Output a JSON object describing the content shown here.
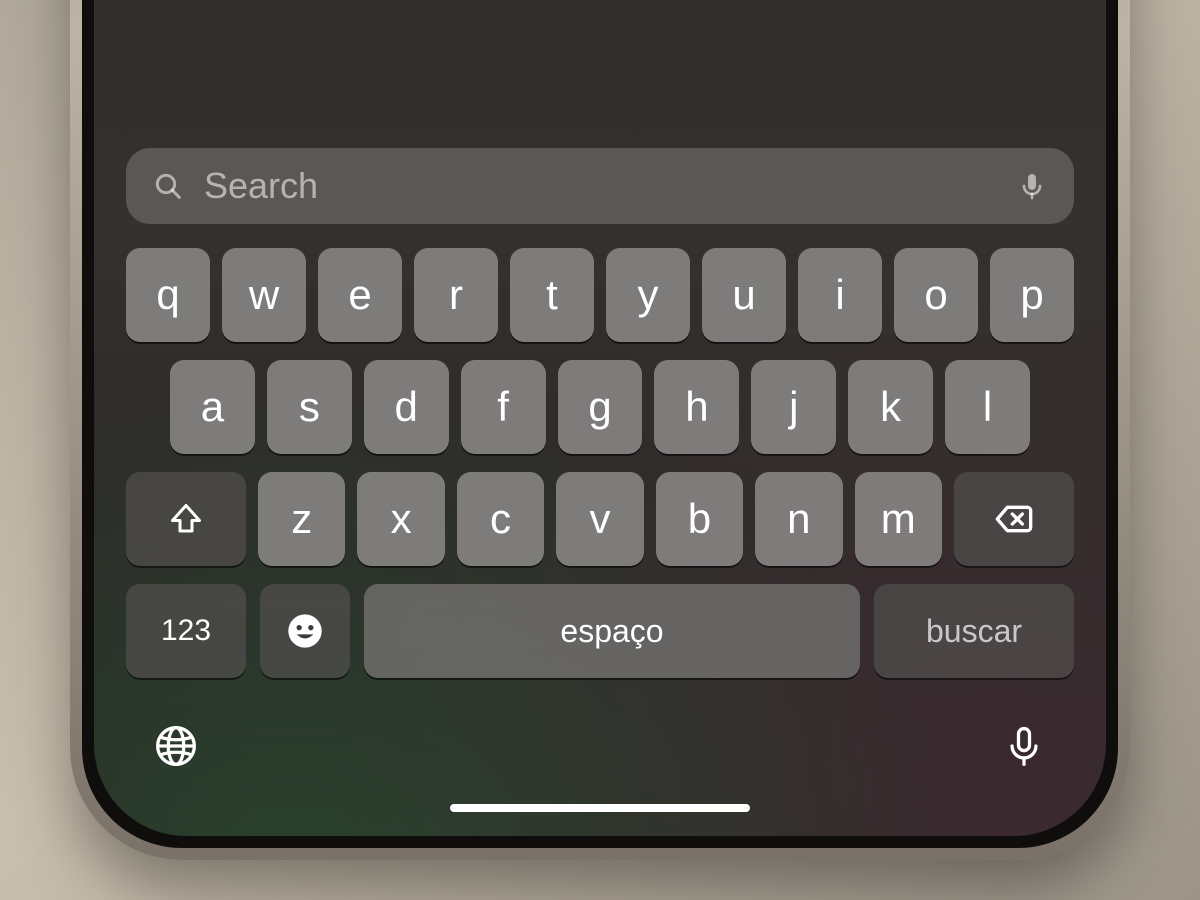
{
  "search": {
    "placeholder": "Search",
    "value": ""
  },
  "keyboard": {
    "row1": [
      "q",
      "w",
      "e",
      "r",
      "t",
      "y",
      "u",
      "i",
      "o",
      "p"
    ],
    "row2": [
      "a",
      "s",
      "d",
      "f",
      "g",
      "h",
      "j",
      "k",
      "l"
    ],
    "row3": [
      "z",
      "x",
      "c",
      "v",
      "b",
      "n",
      "m"
    ],
    "numeric_label": "123",
    "space_label": "espaço",
    "return_label": "buscar"
  }
}
